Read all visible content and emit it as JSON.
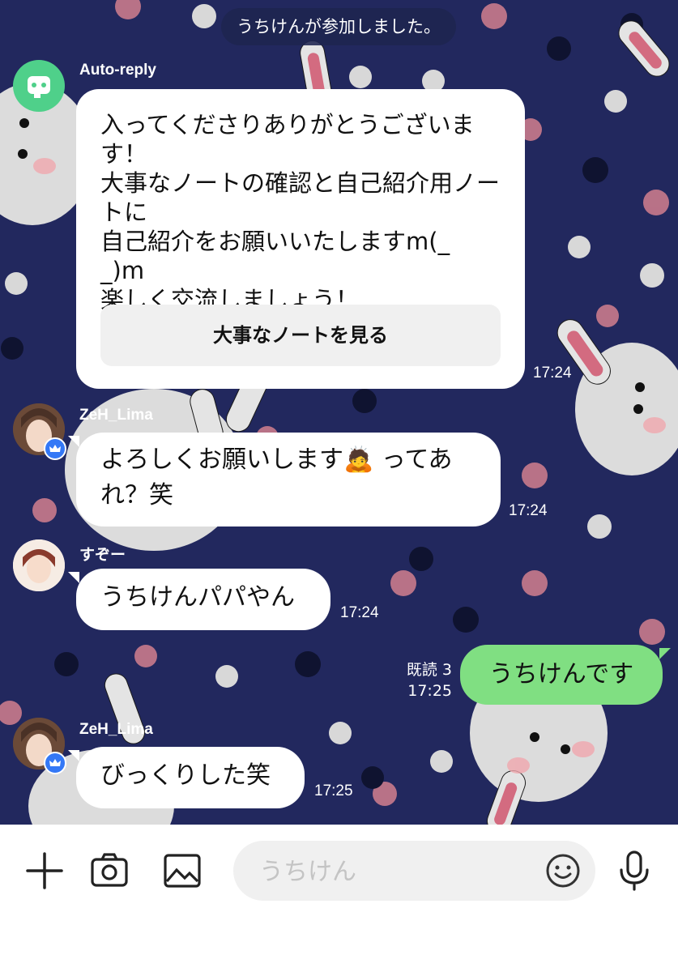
{
  "system_notice": "うちけんが参加しました。",
  "messages": {
    "auto_reply": {
      "sender": "Auto-reply",
      "lines": [
        "入ってくださりありがとうございま",
        "す！",
        "大事なノートの確認と自己紹介用ノー",
        "トに",
        "自己紹介をお願いいたしますm(_ _)m",
        "楽しく交流しましょう！"
      ],
      "button": "大事なノートを見る",
      "time": "17:24"
    },
    "msg1": {
      "sender": "ZeH_Lima",
      "line1": "よろしくお願いします🙇 ってあ",
      "line2": "れ？笑",
      "time": "17:24"
    },
    "msg2": {
      "sender": "すぞー",
      "text": "うちけんパパやん",
      "time": "17:24"
    },
    "mine": {
      "text": "うちけんです",
      "read": "既読 3",
      "time": "17:25"
    },
    "msg3": {
      "sender": "ZeH_Lima",
      "text": "びっくりした笑",
      "time": "17:25"
    }
  },
  "input": {
    "placeholder": "うちけん",
    "icons": [
      "plus-icon",
      "camera-icon",
      "image-icon",
      "emoji-icon",
      "microphone-icon"
    ]
  },
  "colors": {
    "background": "#22285e",
    "my_bubble": "#80df82",
    "crown_badge": "#3478f6",
    "bot_avatar": "#4fd08a"
  }
}
